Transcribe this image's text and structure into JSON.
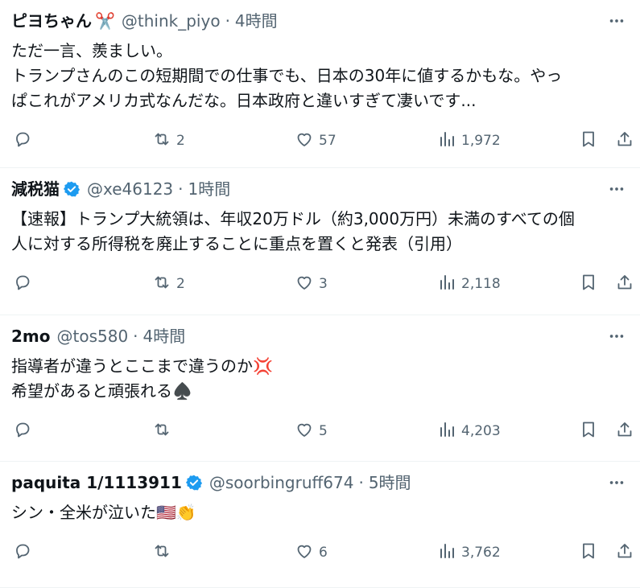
{
  "tweets": [
    {
      "name": "ピヨちゃん",
      "name_emoji": "✂️",
      "handle": "@think_piyo",
      "separator": "·",
      "time": "4時間",
      "lines": [
        "ただ一言、羨ましい。",
        "トランプさんのこの短期間での仕事でも、日本の30年に値するかもな。やっ",
        "ぱこれがアメリカ式なんだな。日本政府と違いすぎて凄いです..."
      ],
      "verified": false,
      "replies": "",
      "retweets": "2",
      "likes": "57",
      "views": "1,972"
    },
    {
      "name": "減税猫",
      "handle": "@xe46123",
      "separator": "·",
      "time": "1時間",
      "lines": [
        "【速報】トランプ大統領は、年収20万ドル（約3,000万円）未満のすべての個",
        "人に対する所得税を廃止することに重点を置くと発表（引用）"
      ],
      "verified": true,
      "replies": "",
      "retweets": "2",
      "likes": "3",
      "views": "2,118"
    },
    {
      "name": "2mo",
      "handle": "@tos580",
      "separator": "·",
      "time": "4時間",
      "lines": [
        "指導者が違うとここまで違うのか💢",
        "希望があると頑張れる♠️"
      ],
      "verified": false,
      "replies": "",
      "retweets": "",
      "likes": "5",
      "views": "4,203"
    },
    {
      "name": "paquita 1/1113911",
      "handle": "@soorbingruff674",
      "separator": "·",
      "time": "5時間",
      "lines": [
        "シン・全米が泣いた🇺🇸👏"
      ],
      "verified": true,
      "replies": "",
      "retweets": "",
      "likes": "6",
      "views": "3,762"
    }
  ],
  "colors": {
    "text": "#0f1419",
    "secondary": "#536471",
    "divider": "#eff3f4",
    "verified": "#1d9bf0"
  },
  "icons": [
    "reply-icon",
    "retweet-icon",
    "like-icon",
    "views-icon",
    "bookmark-icon",
    "share-icon",
    "more-icon",
    "verified-badge-icon"
  ]
}
